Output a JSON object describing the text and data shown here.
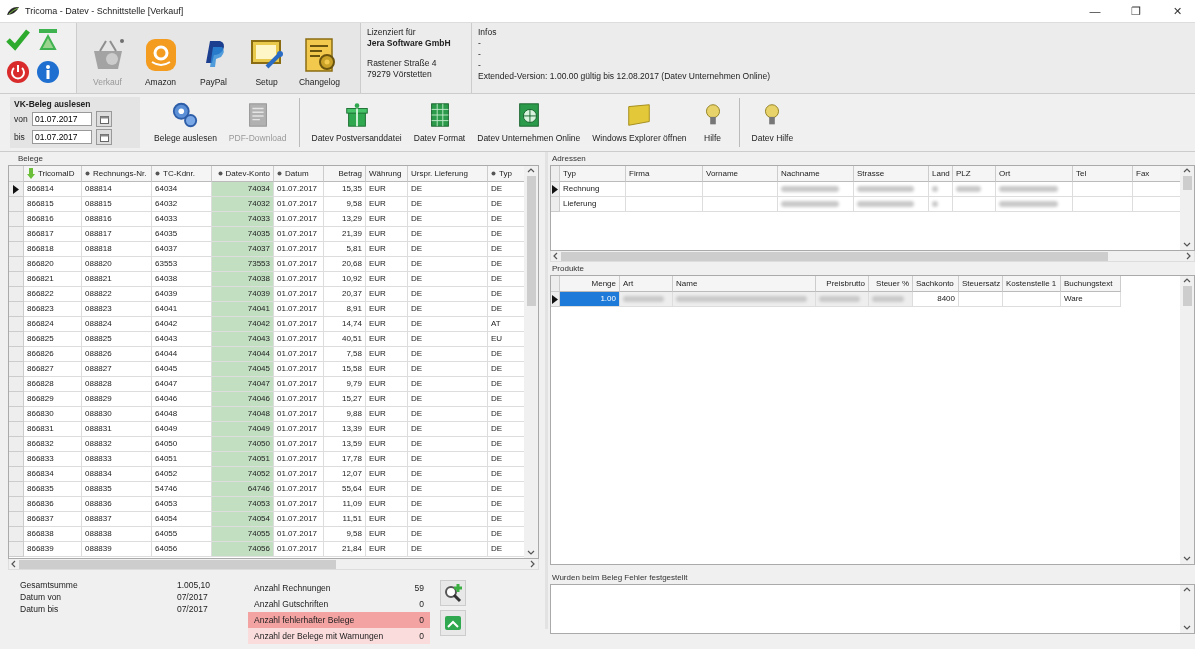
{
  "window": {
    "title": "Tricoma - Datev - Schnittstelle [Verkauf]",
    "controls": [
      "—",
      "❐",
      "✕"
    ]
  },
  "toolbar": {
    "buttons": [
      {
        "label": "Verkauf",
        "disabled": true
      },
      {
        "label": "Amazon",
        "disabled": false
      },
      {
        "label": "PayPal",
        "disabled": false
      },
      {
        "label": "Setup",
        "disabled": false
      },
      {
        "label": "Changelog",
        "disabled": false
      }
    ],
    "license": {
      "heading": "Lizenziert für",
      "company": "Jera Software GmbH",
      "street": "Rastener Straße 4",
      "city": "79279 Vörstetten"
    },
    "infos": {
      "heading": "Infos",
      "lines": [
        "-",
        "-",
        "-"
      ],
      "version": "Extended-Version: 1.00.00 gültig bis 12.08.2017 (Datev Unternehmen Online)"
    }
  },
  "read_group": {
    "title": "VK-Beleg auslesen",
    "from_label": "von",
    "from": "01.07.2017",
    "to_label": "bis",
    "to": "01.07.2017"
  },
  "actions": [
    {
      "label": "Belege auslesen",
      "disabled": false
    },
    {
      "label": "PDF-Download",
      "disabled": true
    },
    {
      "label": "Datev Postversanddatei",
      "disabled": false
    },
    {
      "label": "Datev Format",
      "disabled": false
    },
    {
      "label": "Datev Unternehmen Online",
      "disabled": false
    },
    {
      "label": "Windows Explorer öffnen",
      "disabled": false
    },
    {
      "label": "Hilfe",
      "disabled": false
    },
    {
      "label": "Datev Hilfe",
      "disabled": false
    }
  ],
  "belege": {
    "title": "Belege",
    "columns": [
      {
        "label": "TricomaID",
        "sorted": true,
        "filter": false,
        "highlight": false
      },
      {
        "label": "Rechnungs-Nr.",
        "sorted": false,
        "filter": true,
        "highlight": false
      },
      {
        "label": "TC-Kdnr.",
        "sorted": false,
        "filter": true,
        "highlight": false
      },
      {
        "label": "Datev-Konto",
        "sorted": false,
        "filter": true,
        "highlight": true
      },
      {
        "label": "Datum",
        "sorted": false,
        "filter": true,
        "highlight": false
      },
      {
        "label": "Betrag",
        "sorted": false,
        "filter": false,
        "highlight": false
      },
      {
        "label": "Währung",
        "sorted": false,
        "filter": false,
        "highlight": false
      },
      {
        "label": "Urspr. Lieferung",
        "sorted": false,
        "filter": false,
        "highlight": false
      },
      {
        "label": "Typ",
        "sorted": false,
        "filter": true,
        "highlight": false
      }
    ],
    "rows": [
      {
        "selected": true,
        "cells": [
          "866814",
          "088814",
          "64034",
          "74034",
          "01.07.2017",
          "15,35",
          "EUR",
          "DE",
          "DE"
        ]
      },
      {
        "selected": false,
        "cells": [
          "866815",
          "088815",
          "64032",
          "74032",
          "01.07.2017",
          "9,58",
          "EUR",
          "DE",
          "DE"
        ]
      },
      {
        "selected": false,
        "cells": [
          "866816",
          "088816",
          "64033",
          "74033",
          "01.07.2017",
          "13,29",
          "EUR",
          "DE",
          "DE"
        ]
      },
      {
        "selected": false,
        "cells": [
          "866817",
          "088817",
          "64035",
          "74035",
          "01.07.2017",
          "21,39",
          "EUR",
          "DE",
          "DE"
        ]
      },
      {
        "selected": false,
        "cells": [
          "866818",
          "088818",
          "64037",
          "74037",
          "01.07.2017",
          "5,81",
          "EUR",
          "DE",
          "DE"
        ]
      },
      {
        "selected": false,
        "cells": [
          "866820",
          "088820",
          "63553",
          "73553",
          "01.07.2017",
          "20,68",
          "EUR",
          "DE",
          "DE"
        ]
      },
      {
        "selected": false,
        "cells": [
          "866821",
          "088821",
          "64038",
          "74038",
          "01.07.2017",
          "10,92",
          "EUR",
          "DE",
          "DE"
        ]
      },
      {
        "selected": false,
        "cells": [
          "866822",
          "088822",
          "64039",
          "74039",
          "01.07.2017",
          "20,37",
          "EUR",
          "DE",
          "DE"
        ]
      },
      {
        "selected": false,
        "cells": [
          "866823",
          "088823",
          "64041",
          "74041",
          "01.07.2017",
          "8,91",
          "EUR",
          "DE",
          "DE"
        ]
      },
      {
        "selected": false,
        "cells": [
          "866824",
          "088824",
          "64042",
          "74042",
          "01.07.2017",
          "14,74",
          "EUR",
          "DE",
          "AT"
        ]
      },
      {
        "selected": false,
        "cells": [
          "866825",
          "088825",
          "64043",
          "74043",
          "01.07.2017",
          "40,51",
          "EUR",
          "DE",
          "EU"
        ]
      },
      {
        "selected": false,
        "cells": [
          "866826",
          "088826",
          "64044",
          "74044",
          "01.07.2017",
          "7,58",
          "EUR",
          "DE",
          "DE"
        ]
      },
      {
        "selected": false,
        "cells": [
          "866827",
          "088827",
          "64045",
          "74045",
          "01.07.2017",
          "15,58",
          "EUR",
          "DE",
          "DE"
        ]
      },
      {
        "selected": false,
        "cells": [
          "866828",
          "088828",
          "64047",
          "74047",
          "01.07.2017",
          "9,79",
          "EUR",
          "DE",
          "DE"
        ]
      },
      {
        "selected": false,
        "cells": [
          "866829",
          "088829",
          "64046",
          "74046",
          "01.07.2017",
          "15,27",
          "EUR",
          "DE",
          "DE"
        ]
      },
      {
        "selected": false,
        "cells": [
          "866830",
          "088830",
          "64048",
          "74048",
          "01.07.2017",
          "9,88",
          "EUR",
          "DE",
          "DE"
        ]
      },
      {
        "selected": false,
        "cells": [
          "866831",
          "088831",
          "64049",
          "74049",
          "01.07.2017",
          "13,39",
          "EUR",
          "DE",
          "DE"
        ]
      },
      {
        "selected": false,
        "cells": [
          "866832",
          "088832",
          "64050",
          "74050",
          "01.07.2017",
          "13,59",
          "EUR",
          "DE",
          "DE"
        ]
      },
      {
        "selected": false,
        "cells": [
          "866833",
          "088833",
          "64051",
          "74051",
          "01.07.2017",
          "17,78",
          "EUR",
          "DE",
          "DE"
        ]
      },
      {
        "selected": false,
        "cells": [
          "866834",
          "088834",
          "64052",
          "74052",
          "01.07.2017",
          "12,07",
          "EUR",
          "DE",
          "DE"
        ]
      },
      {
        "selected": false,
        "cells": [
          "866835",
          "088835",
          "54746",
          "64746",
          "01.07.2017",
          "55,64",
          "EUR",
          "DE",
          "DE"
        ]
      },
      {
        "selected": false,
        "cells": [
          "866836",
          "088836",
          "64053",
          "74053",
          "01.07.2017",
          "11,09",
          "EUR",
          "DE",
          "DE"
        ]
      },
      {
        "selected": false,
        "cells": [
          "866837",
          "088837",
          "64054",
          "74054",
          "01.07.2017",
          "11,51",
          "EUR",
          "DE",
          "DE"
        ]
      },
      {
        "selected": false,
        "cells": [
          "866838",
          "088838",
          "64055",
          "74055",
          "01.07.2017",
          "9,58",
          "EUR",
          "DE",
          "DE"
        ]
      },
      {
        "selected": false,
        "cells": [
          "866839",
          "088839",
          "64056",
          "74056",
          "01.07.2017",
          "21,84",
          "EUR",
          "DE",
          "DE"
        ]
      }
    ]
  },
  "summary": {
    "totals": [
      {
        "label": "Gesamtsumme",
        "value": "1.005,10"
      },
      {
        "label": "Datum von",
        "value": "07/2017"
      },
      {
        "label": "Datum bis",
        "value": "07/2017"
      }
    ],
    "counts": [
      {
        "label": "Anzahl Rechnungen",
        "value": "59"
      },
      {
        "label": "Anzahl Gutschriften",
        "value": "0"
      },
      {
        "label": "Anzahl fehlerhafter Belege",
        "value": "0",
        "color": "#f4a3a3"
      },
      {
        "label": "Anzahl der Belege mit Warnungen",
        "value": "0",
        "color": "#fbdcdc"
      }
    ]
  },
  "adressen": {
    "title": "Adressen",
    "columns": [
      "Typ",
      "Firma",
      "Vorname",
      "Nachname",
      "Strasse",
      "Land",
      "PLZ",
      "Ort",
      "Tel",
      "Fax"
    ],
    "rows": [
      {
        "typ": "Rechnung",
        "selected": true,
        "blurred": [
          false,
          false,
          false,
          true,
          true,
          true,
          true,
          true,
          false,
          false
        ]
      },
      {
        "typ": "Lieferung",
        "selected": false,
        "blurred": [
          false,
          false,
          false,
          true,
          true,
          true,
          false,
          true,
          false,
          false
        ]
      }
    ]
  },
  "produkte": {
    "title": "Produkte",
    "columns": [
      "Menge",
      "Art",
      "Name",
      "Preisbrutto",
      "Steuer %",
      "Sachkonto",
      "Steuersatz",
      "Kostenstelle 1",
      "Buchungstext"
    ],
    "rows": [
      {
        "selected": true,
        "menge": "1.00",
        "sachkonto": "8400",
        "buchungstext": "Ware",
        "blurred": [
          false,
          true,
          true,
          true,
          true,
          false,
          false,
          false,
          false
        ]
      }
    ]
  },
  "errors": {
    "label": "Wurden beim Beleg Fehler festgestellt"
  }
}
